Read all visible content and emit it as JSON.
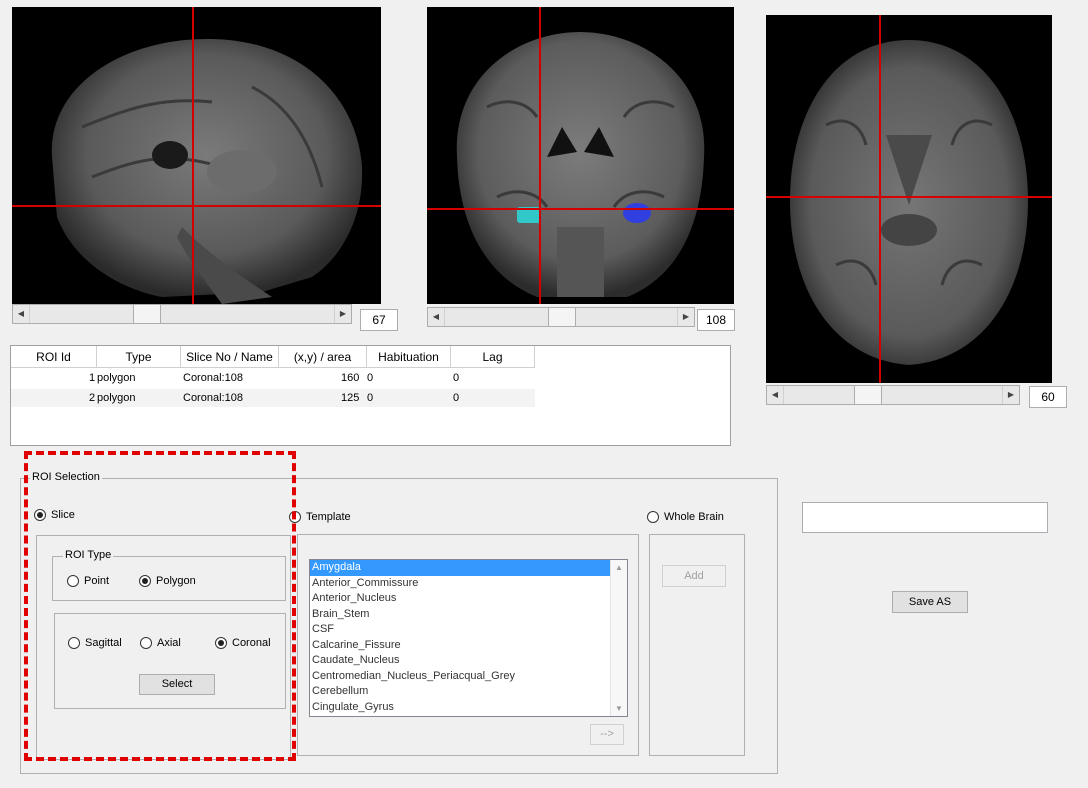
{
  "views": {
    "sagittal": {
      "slice_value": "67",
      "slider_fraction": 0.37
    },
    "coronal": {
      "slice_value": "108",
      "slider_fraction": 0.47
    },
    "axial": {
      "slice_value": "60",
      "slider_fraction": 0.35
    }
  },
  "colors": {
    "crosshair": "#d40000",
    "roi_left": "#30c8c8",
    "roi_right": "#3040e0",
    "highlight_box": "#e00000"
  },
  "roi_table": {
    "headers": [
      "ROI Id",
      "Type",
      "Slice No / Name",
      "(x,y) / area",
      "Habituation",
      "Lag"
    ],
    "rows": [
      {
        "id": "1",
        "type": "polygon",
        "slice": "Coronal:108",
        "area": "160",
        "habituation": "0",
        "lag": "0"
      },
      {
        "id": "2",
        "type": "polygon",
        "slice": "Coronal:108",
        "area": "125",
        "habituation": "0",
        "lag": "0"
      }
    ]
  },
  "roi_selection": {
    "title": "ROI Selection",
    "slice_label": "Slice",
    "template_label": "Template",
    "whole_brain_label": "Whole Brain",
    "roi_type_title": "ROI Type",
    "point_label": "Point",
    "polygon_label": "Polygon",
    "sagittal_label": "Sagittal",
    "axial_label": "Axial",
    "coronal_label": "Coronal",
    "select_label": "Select",
    "add_label": "Add",
    "arrow_label": "-->",
    "template_items": [
      "Amygdala",
      "Anterior_Commissure",
      "Anterior_Nucleus",
      "Brain_Stem",
      "CSF",
      "Calcarine_Fissure",
      "Caudate_Nucleus",
      "Centromedian_Nucleus_Periacqual_Grey",
      "Cerebellum",
      "Cingulate_Gyrus"
    ]
  },
  "save": {
    "filename_value": "",
    "save_label": "Save AS"
  }
}
